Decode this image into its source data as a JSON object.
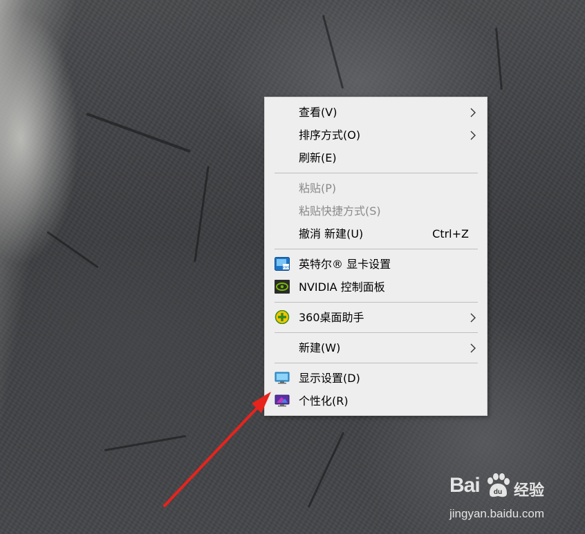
{
  "menu": {
    "items": [
      {
        "label": "查看(V)",
        "has_submenu": true,
        "enabled": true
      },
      {
        "label": "排序方式(O)",
        "has_submenu": true,
        "enabled": true
      },
      {
        "label": "刷新(E)",
        "has_submenu": false,
        "enabled": true
      },
      {
        "label": "粘贴(P)",
        "has_submenu": false,
        "enabled": false
      },
      {
        "label": "粘贴快捷方式(S)",
        "has_submenu": false,
        "enabled": false
      },
      {
        "label": "撤消 新建(U)",
        "shortcut": "Ctrl+Z",
        "has_submenu": false,
        "enabled": true
      },
      {
        "label": "英特尔® 显卡设置",
        "icon": "intel-graphics-icon",
        "has_submenu": false,
        "enabled": true
      },
      {
        "label": "NVIDIA 控制面板",
        "icon": "nvidia-icon",
        "has_submenu": false,
        "enabled": true
      },
      {
        "label": "360桌面助手",
        "icon": "360-desktop-assistant-icon",
        "has_submenu": true,
        "enabled": true
      },
      {
        "label": "新建(W)",
        "has_submenu": true,
        "enabled": true
      },
      {
        "label": "显示设置(D)",
        "icon": "display-settings-icon",
        "has_submenu": false,
        "enabled": true
      },
      {
        "label": "个性化(R)",
        "icon": "personalize-icon",
        "has_submenu": false,
        "enabled": true
      }
    ]
  },
  "annotation": {
    "color": "#e8231c",
    "points_to": "个性化(R)"
  },
  "watermark": {
    "brand": "Bai",
    "brand_suffix": "du",
    "product": "经验",
    "url": "jingyan.baidu.com"
  },
  "colors": {
    "menu_background": "#eeeeee",
    "menu_text": "#000000",
    "disabled_text": "#8a8a8a",
    "separator": "#bdbdbd"
  }
}
